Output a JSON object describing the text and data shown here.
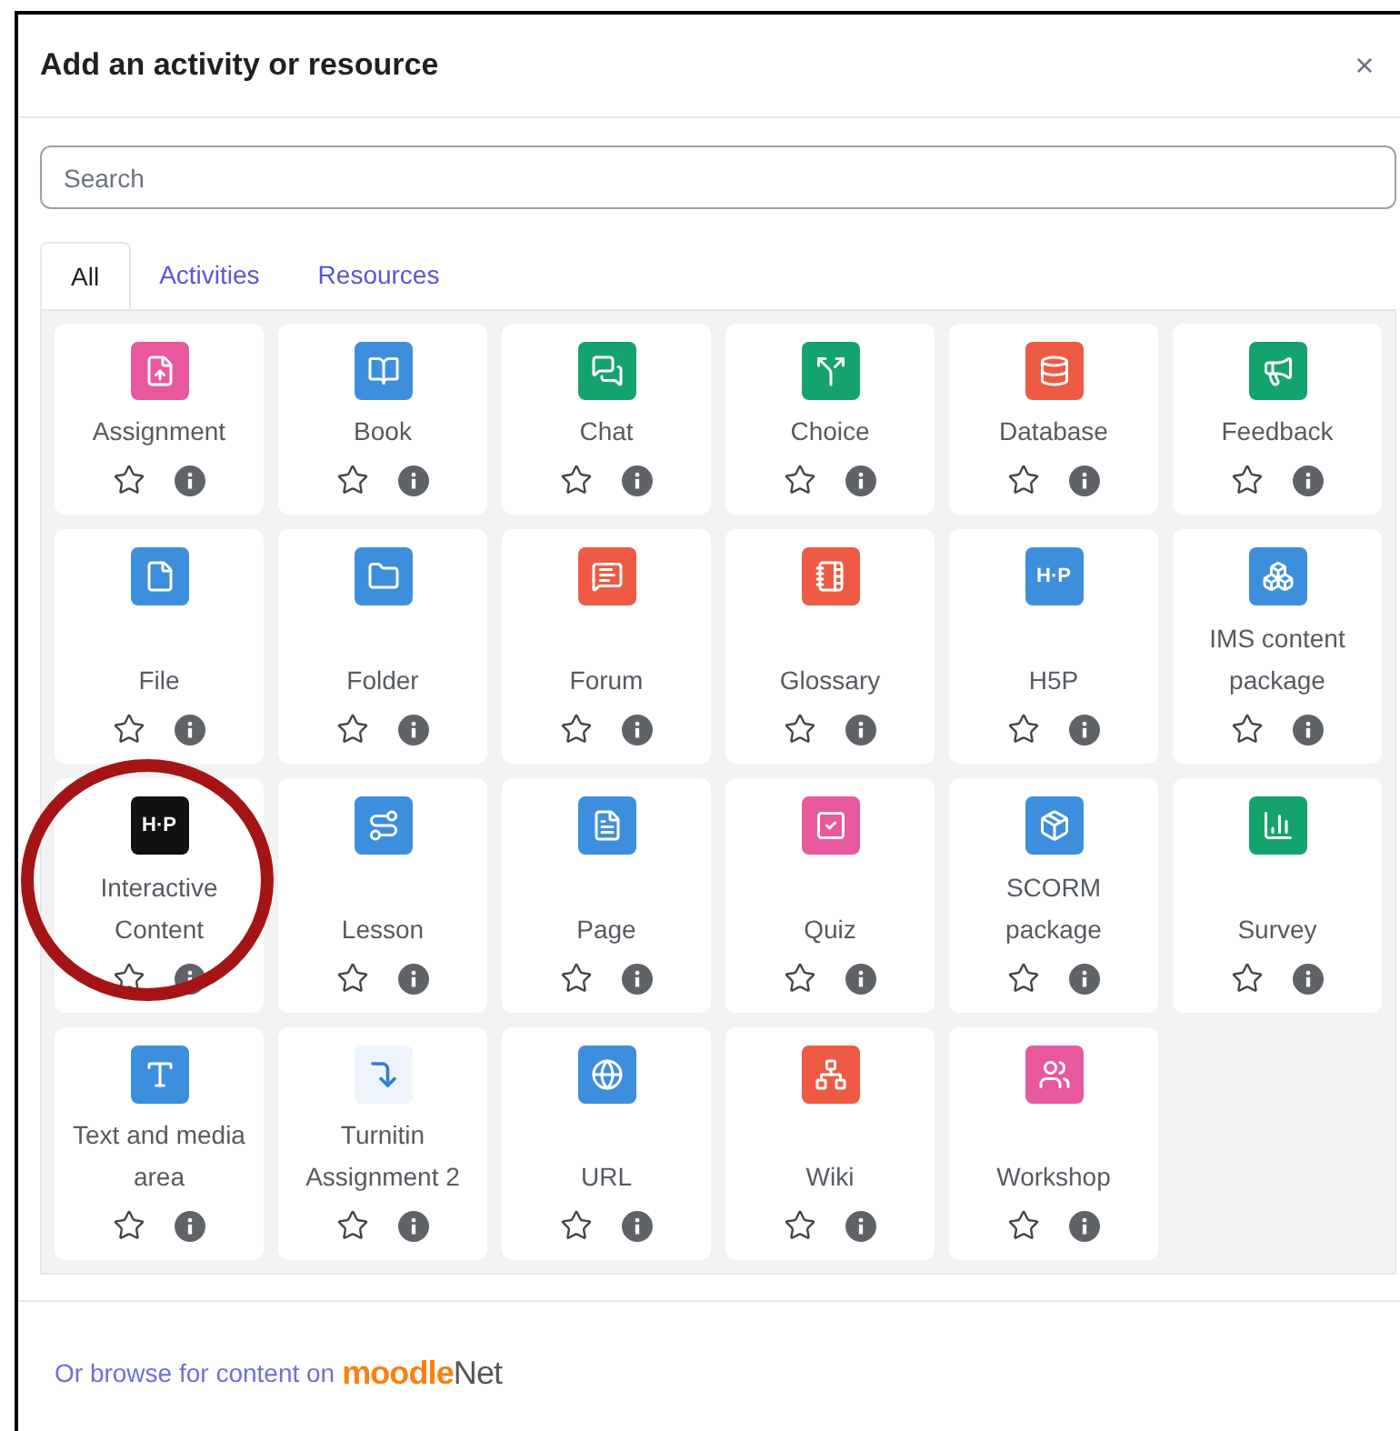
{
  "dialog": {
    "title": "Add an activity or resource",
    "close": "×"
  },
  "search": {
    "placeholder": "Search"
  },
  "tabs": [
    {
      "label": "All",
      "selected": true
    },
    {
      "label": "Activities",
      "selected": false
    },
    {
      "label": "Resources",
      "selected": false
    }
  ],
  "items": [
    {
      "name": "Assignment",
      "color": "#e8589c",
      "kind": "glyph"
    },
    {
      "name": "Book",
      "color": "#3e8ede",
      "kind": "glyph"
    },
    {
      "name": "Chat",
      "color": "#14a36f",
      "kind": "glyph"
    },
    {
      "name": "Choice",
      "color": "#14a36f",
      "kind": "glyph"
    },
    {
      "name": "Database",
      "color": "#ef5a44",
      "kind": "glyph"
    },
    {
      "name": "Feedback",
      "color": "#14a36f",
      "kind": "glyph"
    },
    {
      "name": "File",
      "color": "#3e8ede",
      "kind": "glyph"
    },
    {
      "name": "Folder",
      "color": "#3e8ede",
      "kind": "glyph"
    },
    {
      "name": "Forum",
      "color": "#ef5a44",
      "kind": "glyph"
    },
    {
      "name": "Glossary",
      "color": "#ef5a44",
      "kind": "glyph"
    },
    {
      "name": "H5P",
      "color": "#3e8ede",
      "kind": "text",
      "icon_text": "H·P"
    },
    {
      "name": "IMS content package",
      "color": "#3e8ede",
      "kind": "glyph"
    },
    {
      "name": "Interactive Content",
      "color": "#111111",
      "kind": "text",
      "icon_text": "H·P"
    },
    {
      "name": "Lesson",
      "color": "#3e8ede",
      "kind": "glyph"
    },
    {
      "name": "Page",
      "color": "#3e8ede",
      "kind": "glyph"
    },
    {
      "name": "Quiz",
      "color": "#e8589c",
      "kind": "glyph"
    },
    {
      "name": "SCORM package",
      "color": "#3e8ede",
      "kind": "glyph"
    },
    {
      "name": "Survey",
      "color": "#14a36f",
      "kind": "glyph"
    },
    {
      "name": "Text and media area",
      "color": "#3e8ede",
      "kind": "glyph"
    },
    {
      "name": "Turnitin Assignment 2",
      "color": "#eef4fb",
      "kind": "light"
    },
    {
      "name": "URL",
      "color": "#3e8ede",
      "kind": "glyph"
    },
    {
      "name": "Wiki",
      "color": "#ef5a44",
      "kind": "glyph"
    },
    {
      "name": "Workshop",
      "color": "#e8589c",
      "kind": "glyph"
    }
  ],
  "footer": {
    "link": "Or browse for content on",
    "logo_part_1": "moodle",
    "logo_part_2": "Net"
  }
}
